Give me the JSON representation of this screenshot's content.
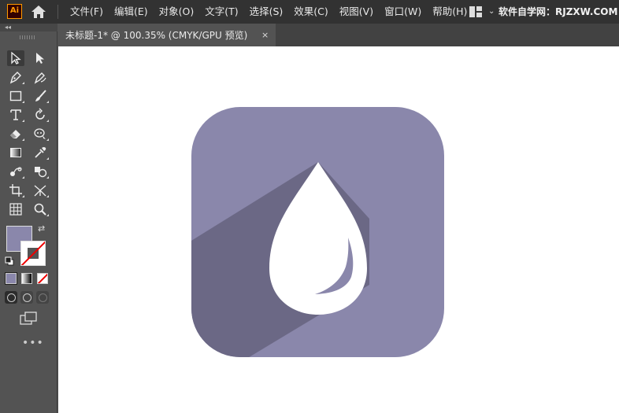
{
  "app": {
    "logo_text": "Ai",
    "menu": [
      "文件(F)",
      "编辑(E)",
      "对象(O)",
      "文字(T)",
      "选择(S)",
      "效果(C)",
      "视图(V)",
      "窗口(W)",
      "帮助(H)"
    ],
    "site_text": "软件自学网：RJZXW.COM"
  },
  "document_tab": {
    "title": "未标题-1* @ 100.35% (CMYK/GPU 预览)",
    "close_label": "×"
  },
  "toolbox": {
    "collapse_label": "◂◂",
    "tools": [
      "selection",
      "direct-selection",
      "pen",
      "curvature",
      "rectangle",
      "paintbrush",
      "type",
      "rotate",
      "eraser",
      "puppet-warp",
      "gradient",
      "eyedropper",
      "blend",
      "shape-builder",
      "artboard",
      "perspective-grid",
      "mesh",
      "zoom"
    ],
    "swap_label": "⇄",
    "more_label": "•••"
  },
  "colors": {
    "fill": "#8a87ab",
    "icon_base": "#8a87ab",
    "long_shadow": "#6b6885",
    "drop": "#ffffff",
    "accent_logo": "#ff9a00"
  },
  "artwork": {
    "icon_name": "water-drop-icon"
  }
}
